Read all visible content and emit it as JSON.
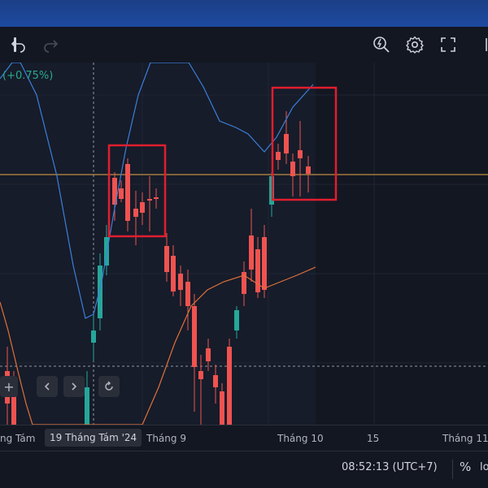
{
  "header": {
    "percent_change": "(+0.75%)"
  },
  "toolbar": {
    "undo_icon": "undo-icon",
    "redo_icon": "redo-icon",
    "lightning_search_icon": "lightning-search-icon",
    "settings_icon": "gear-icon",
    "fullscreen_icon": "fullscreen-icon"
  },
  "nav": {
    "zoom_in": "+",
    "reset_icon": "reset-icon"
  },
  "timeaxis": {
    "labels": [
      "ng Tám",
      "Tháng 9",
      "Tháng 10",
      "15",
      "Tháng 11"
    ],
    "selected": "19 Tháng Tám '24"
  },
  "status": {
    "clock": "08:52:13 (UTC+7)",
    "percent_button": "%",
    "log_button": "lo"
  },
  "colors": {
    "up": "#26a69a",
    "down": "#ef5350",
    "ma_fast": "#3d7fd9",
    "ma_slow": "#e0703a",
    "price_line": "#e8a94a",
    "highlight_box": "#e01e2e",
    "background": "#131722"
  }
}
